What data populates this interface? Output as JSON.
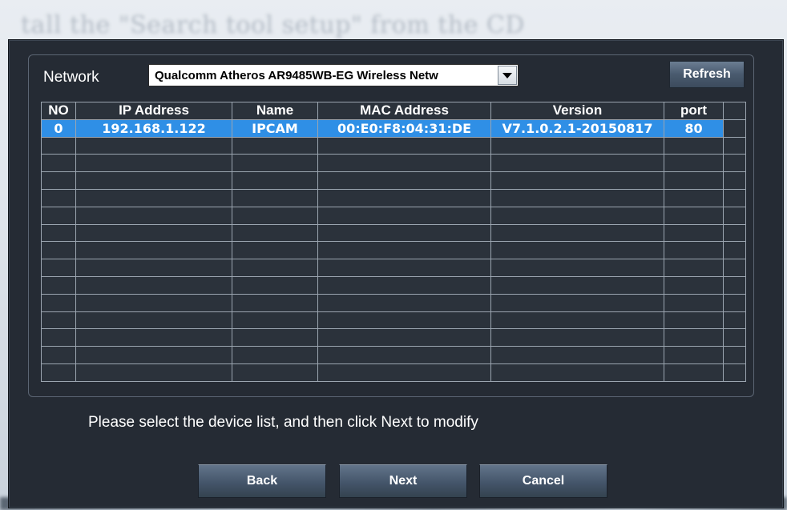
{
  "background_caption": "tall the \"Search tool  setup\" from the CD",
  "network": {
    "label": "Network",
    "selected_adapter": "Qualcomm Atheros AR9485WB-EG Wireless Netw",
    "refresh_label": "Refresh"
  },
  "table": {
    "columns": [
      "NO",
      "IP Address",
      "Name",
      "MAC Address",
      "Version",
      "port"
    ],
    "rows": [
      {
        "no": "0",
        "ip": "192.168.1.122",
        "name": "IPCAM",
        "mac": "00:E0:F8:04:31:DE",
        "version": "V7.1.0.2.1-20150817",
        "port": "80"
      }
    ],
    "empty_row_count": 14,
    "selected_row_color": "#2f8fe6"
  },
  "hint": "Please select the device list, and then click Next to modify",
  "buttons": {
    "back": "Back",
    "next": "Next",
    "cancel": "Cancel"
  },
  "colors": {
    "dialog_bg": "#252b34",
    "accent": "#2f8fe6"
  }
}
